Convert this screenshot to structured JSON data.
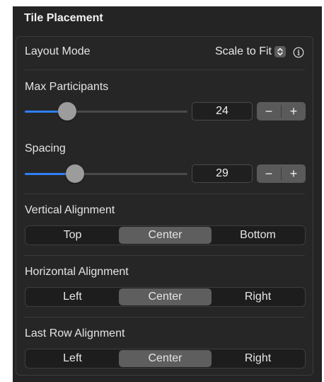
{
  "panel": {
    "title": "Tile Placement"
  },
  "layout_mode": {
    "label": "Layout Mode",
    "value": "Scale to Fit",
    "updown_icon": "chevron-up-down-icon",
    "info_icon": "info-icon"
  },
  "max_participants": {
    "label": "Max Participants",
    "value": "24",
    "slider_fraction": 0.26,
    "decrement_label": "−",
    "increment_label": "+"
  },
  "spacing": {
    "label": "Spacing",
    "value": "29",
    "slider_fraction": 0.31,
    "decrement_label": "−",
    "increment_label": "+"
  },
  "vertical_alignment": {
    "label": "Vertical Alignment",
    "options": [
      "Top",
      "Center",
      "Bottom"
    ],
    "selected": "Center"
  },
  "horizontal_alignment": {
    "label": "Horizontal Alignment",
    "options": [
      "Left",
      "Center",
      "Right"
    ],
    "selected": "Center"
  },
  "last_row_alignment": {
    "label": "Last Row Alignment",
    "options": [
      "Left",
      "Center",
      "Right"
    ],
    "selected": "Center"
  },
  "colors": {
    "panel_background": "#242424",
    "accent": "#2f7ff5",
    "selected_segment": "#5e5e5e"
  }
}
